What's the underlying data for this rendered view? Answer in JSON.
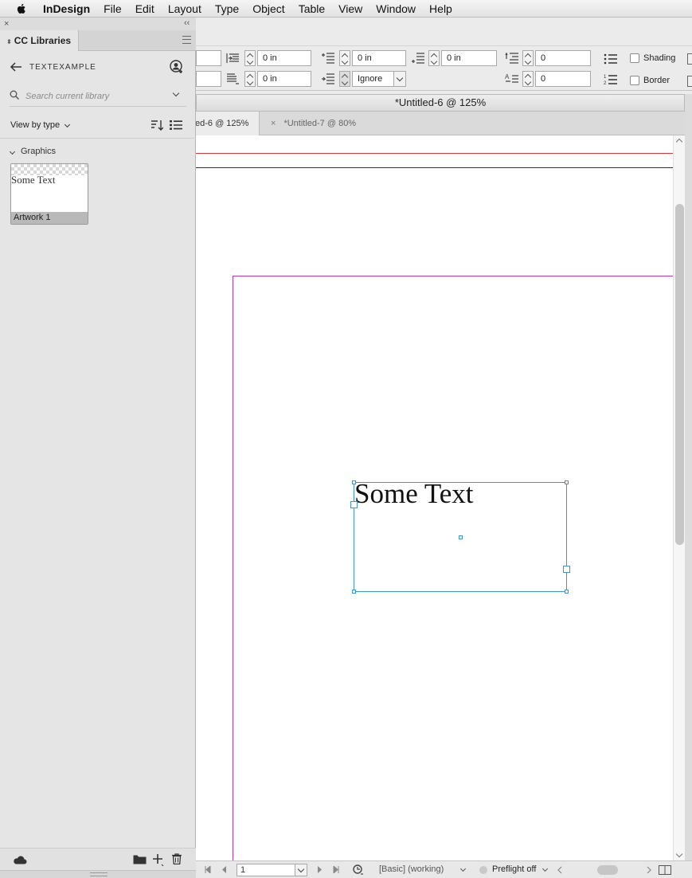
{
  "menubar": {
    "apple_icon": "apple-icon",
    "app_name": "InDesign",
    "items": [
      "File",
      "Edit",
      "Layout",
      "Type",
      "Object",
      "Table",
      "View",
      "Window",
      "Help"
    ]
  },
  "toolbar": {
    "left_indent": "0 in",
    "first_line_indent": "0 in",
    "space_before": "0 in",
    "space_after": "0 in",
    "drop_cap_lines": "0",
    "drop_cap_chars": "0",
    "align_to_grid": "Ignore",
    "shading_label": "Shading",
    "border_label": "Border",
    "shading_checked": false,
    "border_checked": false
  },
  "document": {
    "window_title": "*Untitled-6 @ 125%",
    "tabs": [
      {
        "label": "ed-6 @ 125%",
        "active": true
      },
      {
        "label": "*Untitled-7 @ 80%",
        "active": false
      }
    ],
    "tab_close_glyph": "×",
    "text_frame_content": "Some Text",
    "colors": {
      "guide_red": "#d9383a",
      "page_edge": "#b03ab6",
      "frame_selection": "#3d95d6"
    }
  },
  "statusbar": {
    "page_number": "1",
    "preflight_profile": "[Basic] (working)",
    "preflight_status": "Preflight off"
  },
  "panel": {
    "close_glyph": "×",
    "collapse_glyph": "‹‹",
    "tab_label": "CC Libraries",
    "library_name": "TEXTEXAMPLE",
    "search_placeholder": "Search current library",
    "view_by_label": "View by type",
    "section_label": "Graphics",
    "assets": [
      {
        "preview_text": "Some Text",
        "name": "Artwork 1"
      }
    ]
  }
}
